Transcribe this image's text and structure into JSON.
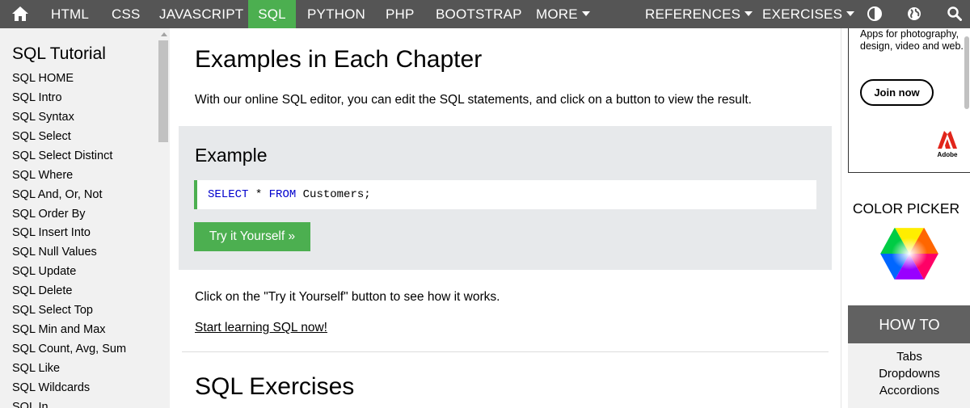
{
  "nav": {
    "home_icon": "home-icon",
    "items": [
      "HTML",
      "CSS",
      "JAVASCRIPT",
      "SQL",
      "PYTHON",
      "PHP",
      "BOOTSTRAP",
      "MORE"
    ],
    "references": "REFERENCES",
    "exercises": "EXERCISES",
    "theme_icon": "contrast-icon",
    "globe_icon": "globe-icon",
    "search_icon": "search-icon",
    "active": "SQL",
    "bar_color": "#555555",
    "active_color": "#4caf50"
  },
  "sidebar": {
    "title": "SQL Tutorial",
    "items": [
      "SQL HOME",
      "SQL Intro",
      "SQL Syntax",
      "SQL Select",
      "SQL Select Distinct",
      "SQL Where",
      "SQL And, Or, Not",
      "SQL Order By",
      "SQL Insert Into",
      "SQL Null Values",
      "SQL Update",
      "SQL Delete",
      "SQL Select Top",
      "SQL Min and Max",
      "SQL Count, Avg, Sum",
      "SQL Like",
      "SQL Wildcards",
      "SQL In"
    ]
  },
  "main": {
    "heading": "Examples in Each Chapter",
    "intro": "With our online SQL editor, you can edit the SQL statements, and click on a button to view the result.",
    "example": {
      "heading": "Example",
      "code_kw1": "SELECT",
      "code_mid": " * ",
      "code_kw2": "FROM",
      "code_rest": " Customers;",
      "button": "Try it Yourself »"
    },
    "click_text": "Click on the \"Try it Yourself\" button to see how it works.",
    "start_link": "Start learning SQL now!",
    "exercises_heading": "SQL Exercises"
  },
  "right": {
    "ad_text": "Apps for photography, design, video and web.",
    "ad_button": "Join now",
    "ad_brand": "Adobe",
    "color_picker_title": "COLOR PICKER",
    "howto_title": "HOW TO",
    "howto_links": [
      "Tabs",
      "Dropdowns",
      "Accordions"
    ]
  }
}
